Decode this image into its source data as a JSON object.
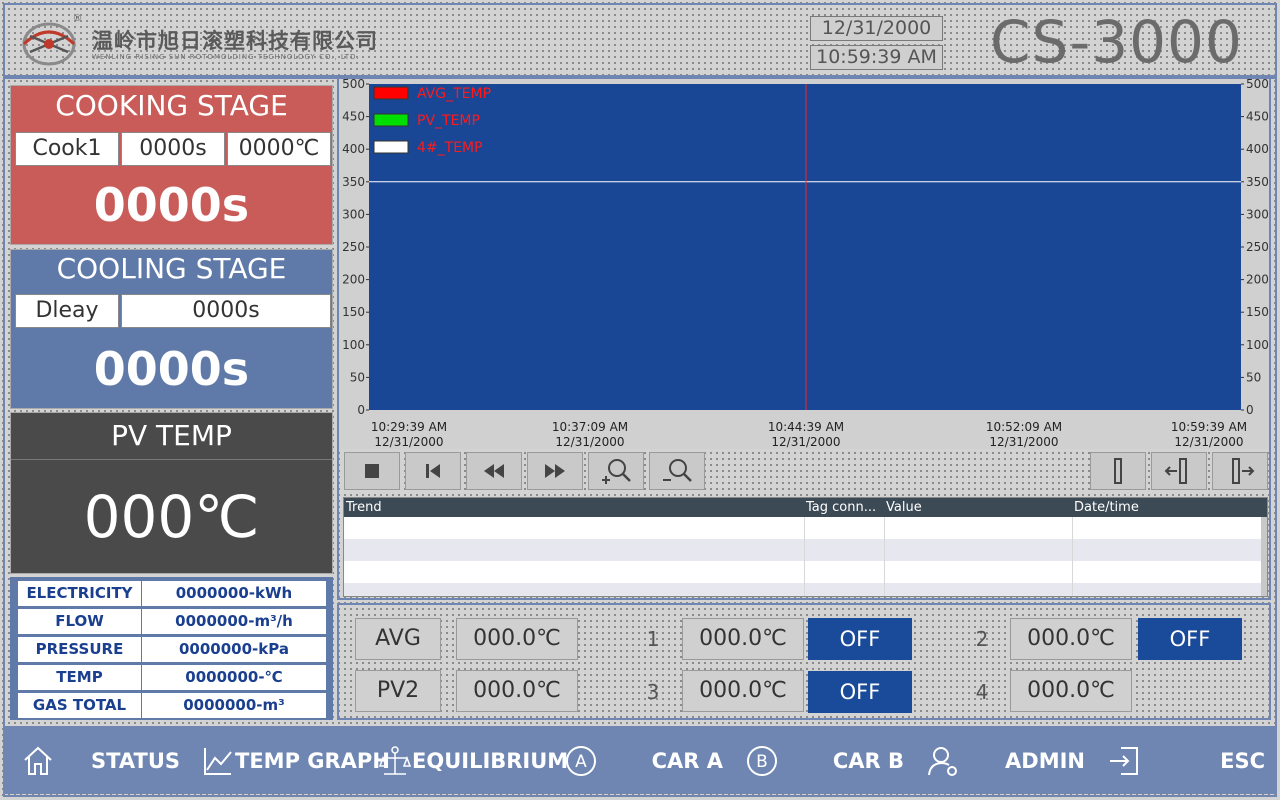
{
  "header": {
    "company_cn": "温岭市旭日滚塑科技有限公司",
    "company_en": "WENLING RISING SUN ROTOMOLDING TECHNOLOGY CO., LTD.",
    "registered_mark": "®",
    "date": "12/31/2000",
    "time": "10:59:39 AM",
    "model": "CS-3000"
  },
  "cooking": {
    "title": "COOKING STAGE",
    "step": "Cook1",
    "step_time": "0000s",
    "step_temp": "0000℃",
    "elapsed": "0000s"
  },
  "cooling": {
    "title": "COOLING STAGE",
    "step": "Dleay",
    "step_time": "0000s",
    "elapsed": "0000s"
  },
  "pv": {
    "title": "PV TEMP",
    "value": "000℃"
  },
  "info": [
    {
      "label": "ELECTRICITY",
      "value": "0000000-kWh"
    },
    {
      "label": "FLOW",
      "value": "0000000-m³/h"
    },
    {
      "label": "PRESSURE",
      "value": "0000000-kPa"
    },
    {
      "label": "TEMP",
      "value": "0000000-℃"
    },
    {
      "label": "GAS TOTAL",
      "value": "0000000-m³"
    }
  ],
  "chart_data": {
    "type": "line",
    "y_ticks": [
      "500",
      "450",
      "400",
      "350",
      "300",
      "250",
      "200",
      "150",
      "100",
      "50",
      "0"
    ],
    "ylim": [
      0,
      500
    ],
    "x_ticks": [
      {
        "time": "10:29:39 AM",
        "date": "12/31/2000"
      },
      {
        "time": "10:37:09 AM",
        "date": "12/31/2000"
      },
      {
        "time": "10:44:39 AM",
        "date": "12/31/2000"
      },
      {
        "time": "10:52:09 AM",
        "date": "12/31/2000"
      },
      {
        "time": "10:59:39 AM",
        "date": "12/31/2000"
      }
    ],
    "series": [
      {
        "name": "AVG_TEMP",
        "color": "#ff0000",
        "values": []
      },
      {
        "name": "PV_TEMP",
        "color": "#00e000",
        "values": []
      },
      {
        "name": "4#_TEMP",
        "color": "#ffffff",
        "values": []
      }
    ],
    "reference_line_y": 350,
    "cursor_x": "10:44:39 AM",
    "grid": false,
    "legend": "top-left",
    "background": "#1a4795"
  },
  "toolbar_icons": [
    "stop-icon",
    "first-icon",
    "rewind-icon",
    "forward-icon",
    "zoom-in-icon",
    "zoom-out-icon",
    "ruler-icon",
    "ruler-left-icon",
    "ruler-right-icon"
  ],
  "table": {
    "headers": [
      "Trend",
      "Tag conn...",
      "Value",
      "Date/time"
    ]
  },
  "readings": {
    "avg_label": "AVG",
    "avg_value": "000.0℃",
    "pv2_label": "PV2",
    "pv2_value": "000.0℃",
    "channels": [
      {
        "num": "1",
        "value": "000.0℃",
        "state": "OFF"
      },
      {
        "num": "2",
        "value": "000.0℃",
        "state": "OFF"
      },
      {
        "num": "3",
        "value": "000.0℃",
        "state": "OFF"
      },
      {
        "num": "4",
        "value": "000.0℃"
      }
    ]
  },
  "nav": [
    {
      "label": "STATUS",
      "icon": "home-icon"
    },
    {
      "label": "TEMP GRAPH",
      "icon": "graph-icon"
    },
    {
      "label": "EQUILIBRIUM",
      "icon": "equilibrium-icon"
    },
    {
      "label": "CAR A",
      "icon": "circle-a-icon",
      "glyph": "A"
    },
    {
      "label": "CAR B",
      "icon": "circle-b-icon",
      "glyph": "B"
    },
    {
      "label": "ADMIN",
      "icon": "user-icon"
    },
    {
      "label": "ESC",
      "icon": "exit-icon"
    }
  ]
}
